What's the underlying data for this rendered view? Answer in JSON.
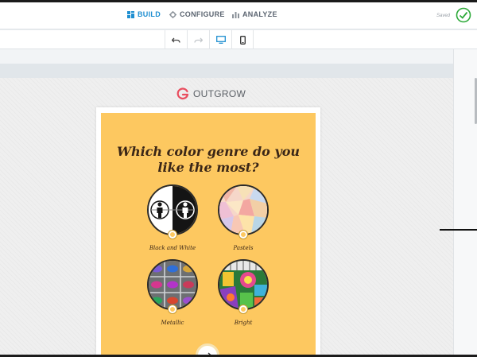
{
  "nav": {
    "tabs": [
      {
        "label": "BUILD",
        "icon": "build-grid-icon",
        "active": true
      },
      {
        "label": "CONFIGURE",
        "icon": "gear-icon",
        "active": false
      },
      {
        "label": "ANALYZE",
        "icon": "bar-chart-icon",
        "active": false
      }
    ],
    "status": "Saved"
  },
  "toolbar": {
    "buttons": [
      "undo-icon",
      "redo-icon",
      "desktop-icon",
      "mobile-icon"
    ],
    "active": "desktop-icon"
  },
  "brand": {
    "name": "OUTGROW",
    "color": "#e94e5f"
  },
  "quiz": {
    "question": "Which color genre do you like the most?",
    "background": "#fdc860",
    "options": [
      {
        "label": "Black and White",
        "image": "black-white-people-icon"
      },
      {
        "label": "Pastels",
        "image": "pastel-polygon-image"
      },
      {
        "label": "Metallic",
        "image": "metallic-cars-image"
      },
      {
        "label": "Bright",
        "image": "bright-pattern-image"
      }
    ],
    "next_icon": "arrow-right-icon"
  },
  "colors": {
    "accent": "#1f8fd1",
    "saved_check": "#2eaa3a",
    "text": "#3a2617"
  }
}
